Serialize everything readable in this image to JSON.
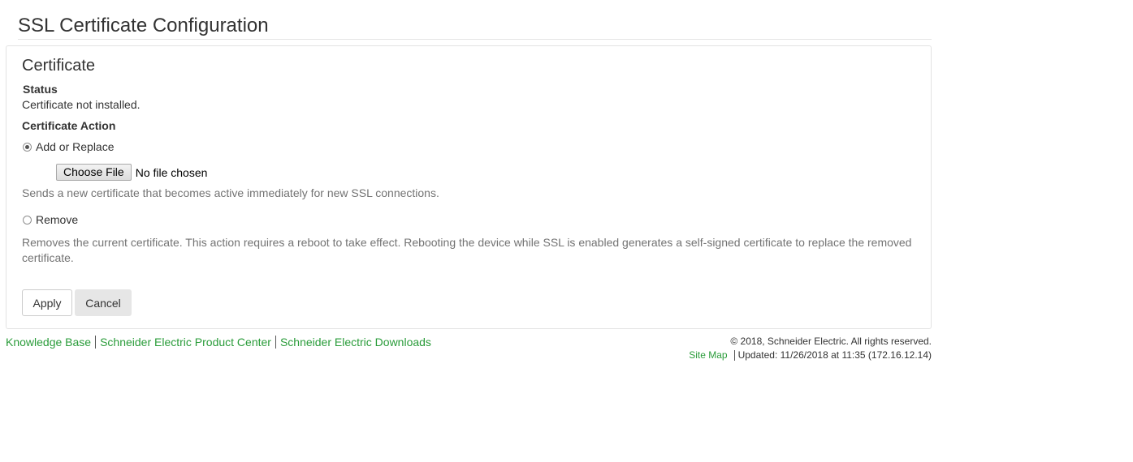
{
  "page": {
    "title": "SSL Certificate Configuration"
  },
  "certificate_panel": {
    "heading": "Certificate",
    "status_label": "Status",
    "status_value": "Certificate not installed.",
    "action_label": "Certificate Action",
    "options": [
      {
        "label": "Add or Replace",
        "selected": true,
        "description": "Sends a new certificate that becomes active immediately for new SSL connections."
      },
      {
        "label": "Remove",
        "selected": false,
        "description": "Removes the current certificate. This action requires a reboot to take effect. Rebooting the device while SSL is enabled generates a self-signed certificate to replace the removed certificate."
      }
    ],
    "file_input": {
      "button_label": "Choose File",
      "status": "No file chosen"
    },
    "buttons": {
      "apply": "Apply",
      "cancel": "Cancel"
    }
  },
  "footer": {
    "links": [
      "Knowledge Base",
      "Schneider Electric Product Center",
      "Schneider Electric Downloads"
    ],
    "copyright": "© 2018, Schneider Electric. All rights reserved.",
    "site_map": "Site Map",
    "updated": "Updated: 11/26/2018 at 11:35 (172.16.12.14)"
  },
  "colors": {
    "link_green": "#2a9c3a",
    "help_text": "#737373",
    "text": "#333333"
  }
}
